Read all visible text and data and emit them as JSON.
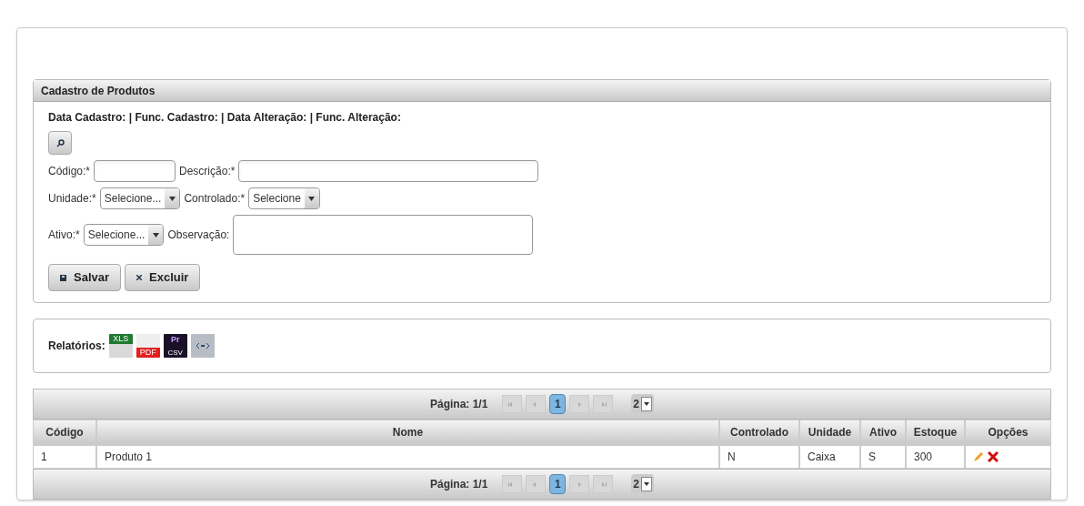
{
  "form_panel": {
    "title": "Cadastro de Produtos",
    "audit_line": "Data Cadastro: | Func. Cadastro: | Data Alteração: | Func. Alteração:",
    "rows": [
      [
        {
          "kind": "text",
          "label": "Código:*"
        },
        {
          "kind": "text",
          "label": "Descrição:*"
        }
      ],
      [
        {
          "kind": "select",
          "label": "Unidade:*",
          "value": "Selecione..."
        },
        {
          "kind": "select",
          "label": "Controlado:*",
          "value": "Selecione"
        }
      ],
      [
        {
          "kind": "select",
          "label": "Ativo:*",
          "value": "Selecione..."
        },
        {
          "kind": "textarea",
          "label": "Observação:"
        }
      ]
    ],
    "buttons": [
      {
        "kind": "save",
        "label": "Salvar"
      },
      {
        "kind": "delete",
        "label": "Excluir"
      }
    ]
  },
  "reports_panel": {
    "label": "Relatórios:",
    "reports": [
      {
        "kind": "xls",
        "label": "XLS"
      },
      {
        "kind": "pdf",
        "label": "PDF"
      },
      {
        "kind": "csv",
        "label": "Pr",
        "sublabel": "CSV"
      },
      {
        "kind": "xml"
      }
    ]
  },
  "table": {
    "paginator_top": {
      "text": "Página: 1/1",
      "pages": [
        {
          "label": "1",
          "selected": true
        }
      ],
      "rows_per_page": "2"
    },
    "columns": [
      "Código",
      "Nome",
      "Controlado",
      "Unidade",
      "Ativo",
      "Estoque",
      "Opções"
    ],
    "rows": [
      {
        "cells": [
          "1",
          "Produto 1",
          "N",
          "Caixa",
          "S",
          "300"
        ]
      }
    ],
    "paginator_bottom": {
      "text": "Página: 1/1",
      "pages": [
        {
          "label": "1",
          "selected": true
        }
      ],
      "rows_per_page": "2"
    }
  }
}
